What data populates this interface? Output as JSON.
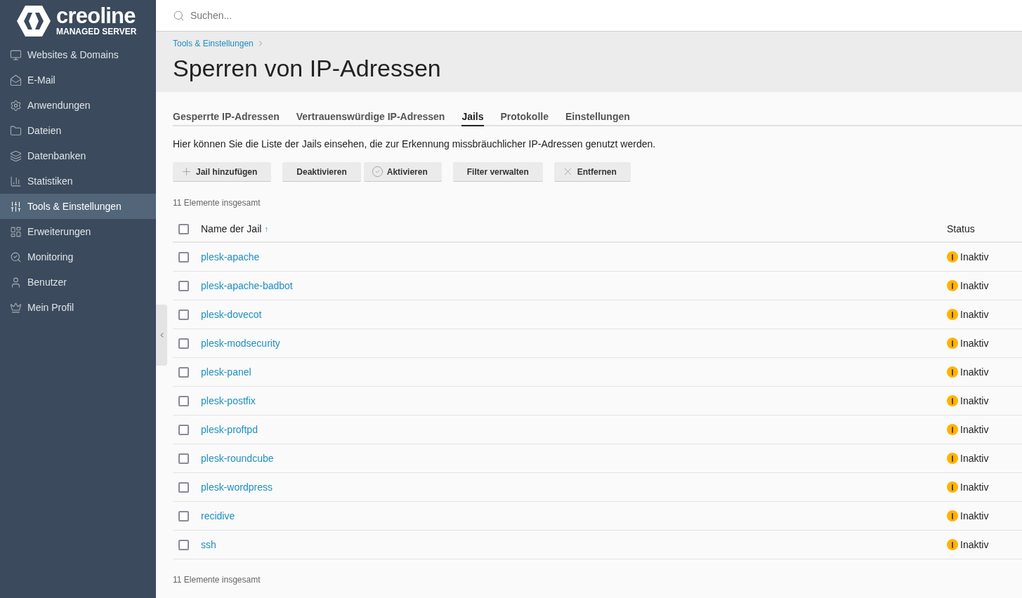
{
  "logo": {
    "name": "creoline",
    "subtitle": "MANAGED SERVER"
  },
  "sidebar": {
    "items": [
      {
        "label": "Websites & Domains",
        "selected": false
      },
      {
        "label": "E-Mail",
        "selected": false
      },
      {
        "label": "Anwendungen",
        "selected": false
      },
      {
        "label": "Dateien",
        "selected": false
      },
      {
        "label": "Datenbanken",
        "selected": false
      },
      {
        "label": "Statistiken",
        "selected": false
      },
      {
        "label": "Tools & Einstellungen",
        "selected": true
      },
      {
        "label": "Erweiterungen",
        "selected": false
      },
      {
        "label": "Monitoring",
        "selected": false
      },
      {
        "label": "Benutzer",
        "selected": false
      },
      {
        "label": "Mein Profil",
        "selected": false
      }
    ]
  },
  "search": {
    "placeholder": "Suchen..."
  },
  "breadcrumb": [
    "Tools & Einstellungen"
  ],
  "title": "Sperren von IP-Adressen",
  "tabs": [
    {
      "label": "Gesperrte IP-Adressen",
      "selected": false
    },
    {
      "label": "Vertrauenswürdige IP-Adressen",
      "selected": false
    },
    {
      "label": "Jails",
      "selected": true
    },
    {
      "label": "Protokolle",
      "selected": false
    },
    {
      "label": "Einstellungen",
      "selected": false
    }
  ],
  "description": "Hier können Sie die Liste der Jails einsehen, die zur Erkennung missbräuchlicher IP-Adressen genutzt werden.",
  "toolbar": [
    {
      "label": "Jail hinzufügen",
      "kind": "add"
    },
    {
      "label": "Deaktivieren",
      "kind": "plain"
    },
    {
      "label": "Aktivieren",
      "kind": "check"
    },
    {
      "label": "Filter verwalten",
      "kind": "plain"
    },
    {
      "label": "Entfernen",
      "kind": "remove"
    }
  ],
  "total_top": "11 Elemente insgesamt",
  "table": {
    "columns": [
      {
        "label": "Name der Jail",
        "sort": "↑"
      },
      {
        "label": "Status"
      }
    ],
    "select_all": {
      "checked": false
    },
    "rows": [
      {
        "name": "plesk-apache",
        "status": "Inaktiv",
        "kind": "inactive",
        "checked": false
      },
      {
        "name": "plesk-apache-badbot",
        "status": "Inaktiv",
        "kind": "inactive",
        "checked": false
      },
      {
        "name": "plesk-dovecot",
        "status": "Inaktiv",
        "kind": "inactive",
        "checked": false
      },
      {
        "name": "plesk-modsecurity",
        "status": "Inaktiv",
        "kind": "inactive",
        "checked": false
      },
      {
        "name": "plesk-panel",
        "status": "Inaktiv",
        "kind": "inactive",
        "checked": false
      },
      {
        "name": "plesk-postfix",
        "status": "Inaktiv",
        "kind": "inactive",
        "checked": false
      },
      {
        "name": "plesk-proftpd",
        "status": "Inaktiv",
        "kind": "inactive",
        "checked": false
      },
      {
        "name": "plesk-roundcube",
        "status": "Inaktiv",
        "kind": "inactive",
        "checked": false
      },
      {
        "name": "plesk-wordpress",
        "status": "Inaktiv",
        "kind": "inactive",
        "checked": false
      },
      {
        "name": "recidive",
        "status": "Inaktiv",
        "kind": "inactive",
        "checked": false
      },
      {
        "name": "ssh",
        "status": "Inaktiv",
        "kind": "inactive",
        "checked": false
      }
    ]
  },
  "total_bottom": "11 Elemente insgesamt"
}
